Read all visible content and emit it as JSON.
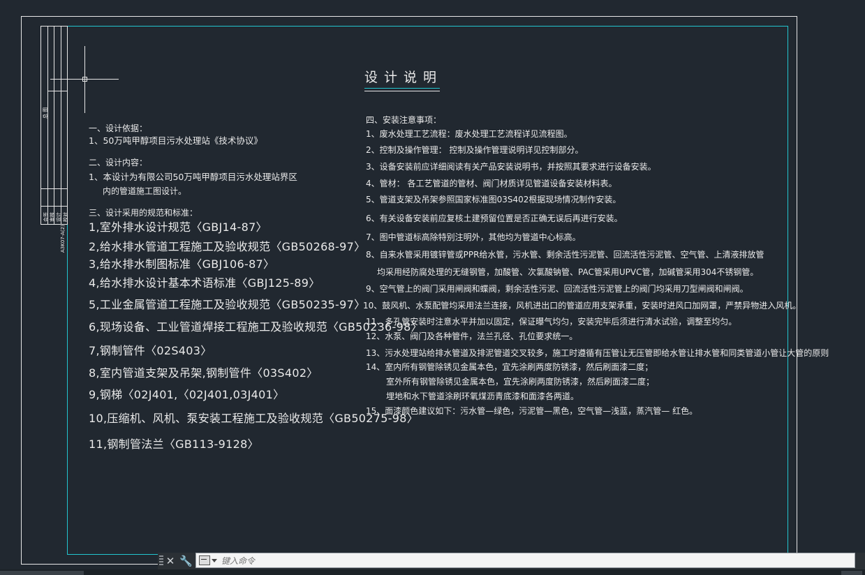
{
  "drawing": {
    "title": "设计说明",
    "left_block": {
      "s1_heading": "一、设计依据：",
      "s1_line1": "1、50万吨甲醇项目污水处理站《技术协议》",
      "s2_heading": "二、设计内容：",
      "s2_line1": "1、本设计为有限公司50万吨甲醇项目污水处理站界区",
      "s2_line2": "内的管道施工图设计。",
      "s3_heading": "三、设计采用的规范和标准：",
      "standards": [
        "1,室外排水设计规范〈GBJ14-87〉",
        "2,给水排水管道工程施工及验收规范〈GB50268-97〉",
        "3,给水排水制图标准〈GBJ106-87〉",
        "4,给水排水设计基本术语标准〈GBJ125-89〉",
        "5,工业金属管道工程施工及验收规范〈GB50235-97〉",
        "6,现场设备、工业管道焊接工程施工及验收规范〈GB50236-98〉",
        "7,钢制管件〈02S403〉",
        "8,室内管道支架及吊架,钢制管件〈03S402〉",
        "9,钢梯〈02J401,〈02J401,03J401〉",
        "10,压缩机、风机、泵安装工程施工及验收规范〈GB50275-98〉",
        "11,钢制管法兰〈GB113-9128〉"
      ]
    },
    "right_block": {
      "s4_heading": "四、安装注意事项：",
      "items": [
        "1、废水处理工艺流程：废水处理工艺流程详见流程图。",
        "2、控制及操作管理： 控制及操作管理说明详见控制部分。",
        "3、设备安装前应详细阅读有关产品安装说明书，并按照其要求进行设备安装。",
        "4、管材： 各工艺管道的管材、阀门材质详见管道设备安装材料表。",
        "5、管道支架及吊架参照国家标准图03S402根据现场情况制作安装。",
        "6、有关设备安装前应复核土建预留位置是否正确无误后再进行安装。",
        "7、图中管道标高除特别注明外，其他均为管道中心标高。",
        "8、自来水管采用镀锌管或PPR给水管，污水管、剩余活性污泥管、回流活性污泥管、空气管、上清液排放管",
        "均采用经防腐处理的无缝钢管，加酸管、次氯酸钠管、PAC管采用UPVC管，加碱管采用304不锈钢管。",
        "9、空气管上的阀门采用闸阀和蝶阀，剩余活性污泥、回流活性污泥管上的阀门均采用刀型闸阀和闸阀。",
        "10、鼓风机、水泵配管均采用法兰连接，风机进出口的管道应用支架承重，安装时进风口加网罩，严禁异物进入风机。",
        "11、多孔管安装时注意水平并加以固定，保证曝气均匀，安装完毕后须进行清水试验，调整至均匀。",
        "12、水泵、阀门及各种管件，法兰孔径、孔位要求统一。",
        "13、污水处理站给排水管道及排泥管道交叉较多，施工时遵循有压管让无压管即给水管让排水管和同类管道小管让大管的原则",
        "14、室内所有钢管除锈见金属本色，宜先涂刷两度防锈漆，然后刷面漆二度；",
        "室外所有钢管除锈见金属本色，宜先涂刷两度防锈漆，然后刷面漆二度；",
        "埋地和水下管道涂刷环氧煤沥青底漆和面漆各两道。",
        "15、面漆颜色建议如下：污水管—绿色，污泥管—黑色，空气管—浅蓝，蒸汽管— 红色。"
      ]
    },
    "stamp_labels": [
      "会签",
      "审核",
      "设计",
      "校对",
      "批准"
    ],
    "stamp_small": "总 图",
    "stamp_code": "A3K07-A(2)"
  },
  "command": {
    "placeholder": "键入命令",
    "close_icon": "close-icon",
    "settings_icon": "wrench-icon"
  },
  "colors": {
    "background": "#212830",
    "frame_white": "#e8e8e8",
    "frame_cyan": "#22c6cf",
    "text": "#eaeaea"
  }
}
